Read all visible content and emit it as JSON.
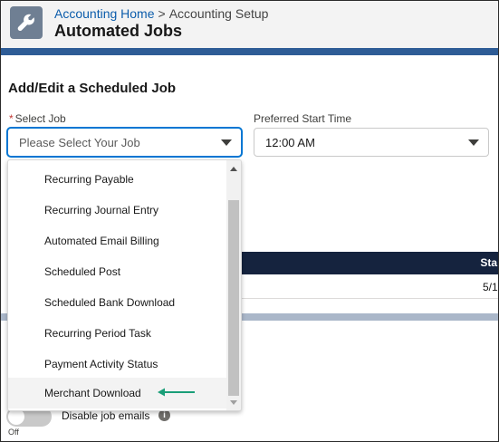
{
  "header": {
    "app_icon": "wrench-icon",
    "breadcrumb": {
      "link": "Accounting Home",
      "separator": ">",
      "current": "Accounting Setup"
    },
    "title": "Automated Jobs"
  },
  "form": {
    "section_title": "Add/Edit a Scheduled Job",
    "select_job": {
      "required_mark": "*",
      "label": "Select Job",
      "placeholder": "Please Select Your Job"
    },
    "start_time": {
      "label": "Preferred Start Time",
      "value": "12:00 AM"
    }
  },
  "dropdown": {
    "options": [
      "Recurring Payable",
      "Recurring Journal Entry",
      "Automated Email Billing",
      "Scheduled Post",
      "Scheduled Bank Download",
      "Recurring Period Task",
      "Payment Activity Status",
      "Merchant Download"
    ],
    "hovered_option": "Merchant Download",
    "annotation_color": "#1a9e78"
  },
  "table": {
    "header_text": "Sta",
    "cell_text": "5/1"
  },
  "settings": {
    "toggle_state": "Off",
    "toggle_label": "Disable job emails",
    "info_icon": "info-icon"
  },
  "colors": {
    "brand_band": "#2e5c96",
    "table_header": "#15233e",
    "link": "#0b5cab",
    "focus": "#0176d3"
  }
}
